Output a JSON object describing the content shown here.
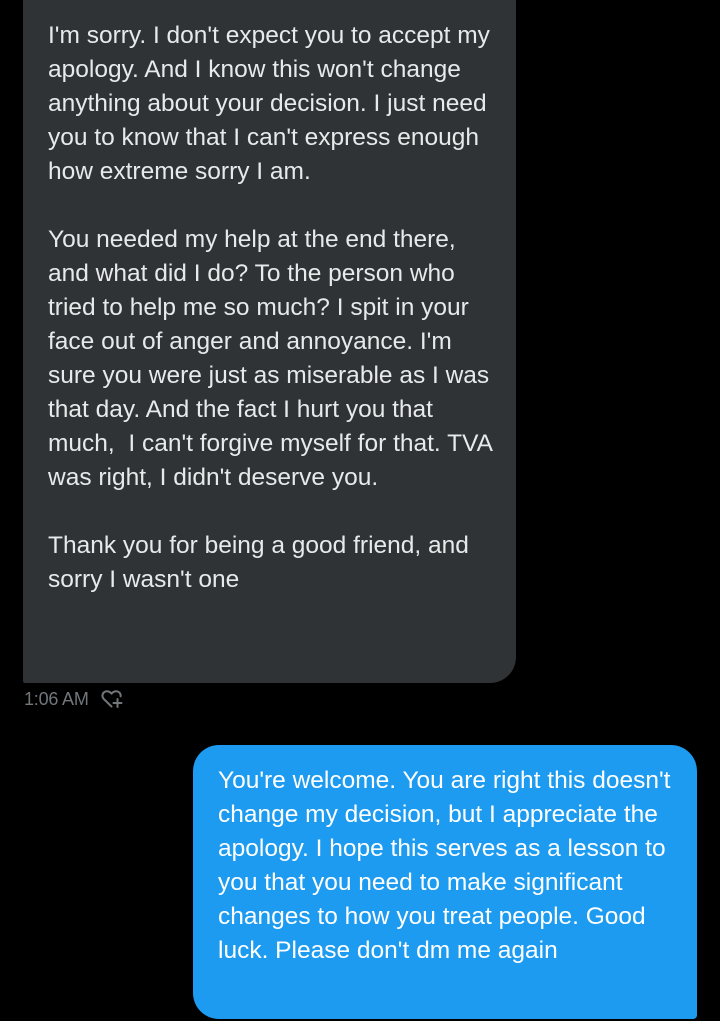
{
  "conversation": {
    "received_message": {
      "paragraphs": [
        "I'm sorry. I don't expect you to accept my apology. And I know this won't change anything about your decision. I just need you to know that I can't express enough how extreme sorry I am.",
        "You needed my help at the end there, and what did I do? To the person who tried to help me so much? I spit in your face out of anger and annoyance. I'm sure you were just as miserable as I was that day. And the fact I hurt you that much,  I can't forgive myself for that. TVA was right, I didn't deserve you.",
        "Thank you for being a good friend, and sorry I wasn't one"
      ],
      "timestamp": "1:06 AM",
      "react_icon": "heart-plus-icon"
    },
    "sent_message": {
      "text": "You're welcome. You are right this doesn't change my decision, but I appreciate the apology. I hope this serves as a lesson to you that you need to make significant changes to how you treat people. Good luck. Please don't dm me again"
    }
  },
  "colors": {
    "background": "#000000",
    "received_bubble": "#2f3336",
    "sent_bubble": "#1d9bf0",
    "timestamp": "#71767b"
  }
}
